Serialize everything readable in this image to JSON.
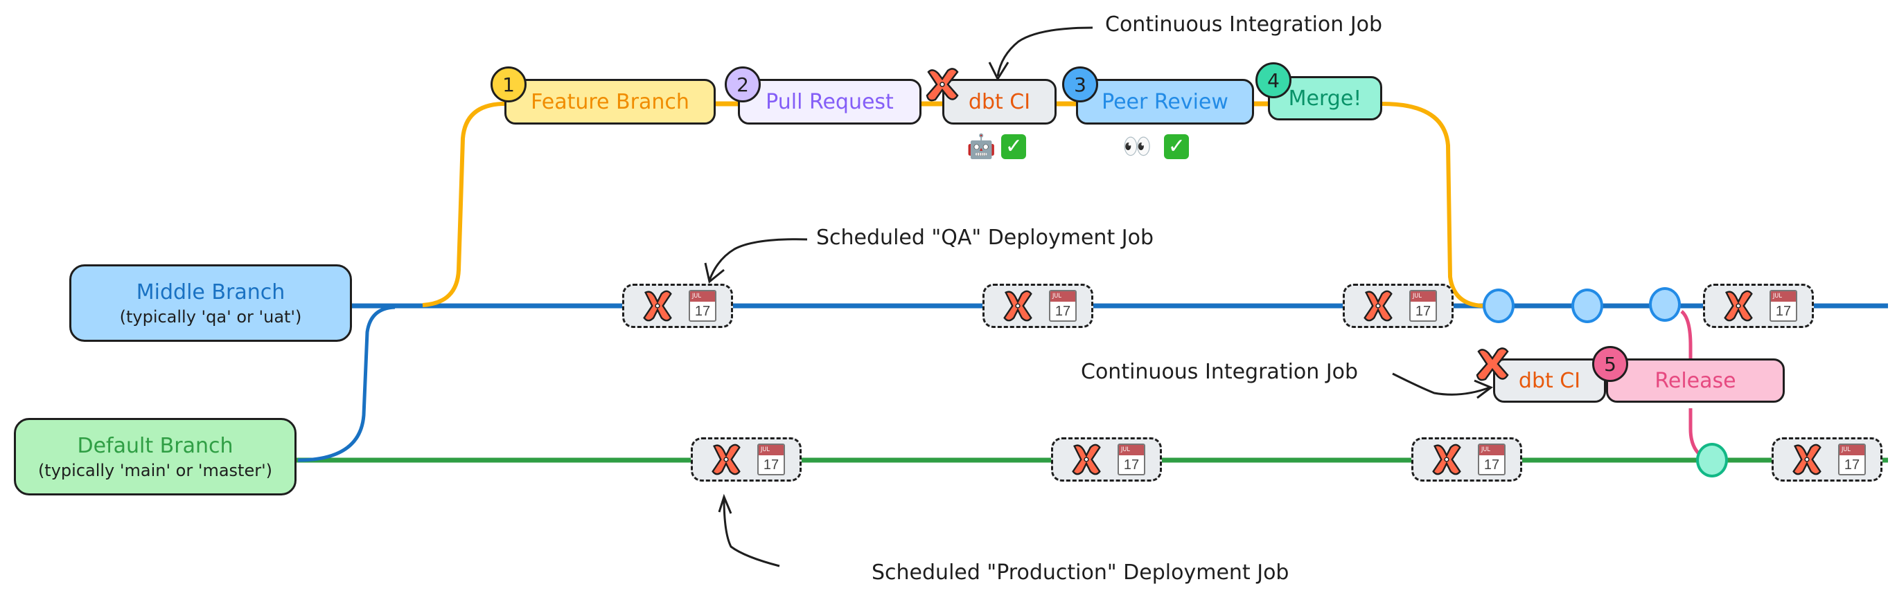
{
  "colors": {
    "middle_line": "#1971c2",
    "default_line": "#2f9e44",
    "feature_line": "#fab005",
    "release_line": "#e64980",
    "dbt_orange": "#ff6849"
  },
  "branches": {
    "middle": {
      "title": "Middle Branch",
      "subtitle": "(typically 'qa' or 'uat')"
    },
    "default": {
      "title": "Default Branch",
      "subtitle": "(typically 'main' or 'master')"
    }
  },
  "steps": [
    {
      "number": "1",
      "label": "Feature Branch"
    },
    {
      "number": "2",
      "label": "Pull Request"
    },
    {
      "number": "3",
      "label": "Peer Review"
    },
    {
      "number": "4",
      "label": "Merge!"
    },
    {
      "number": "5",
      "label": "Release"
    }
  ],
  "ci_nodes": {
    "top": {
      "label": "dbt CI",
      "status_icons": [
        "robot-emoji",
        "check-mark"
      ]
    },
    "bottom": {
      "label": "dbt CI"
    }
  },
  "peer_review_status": [
    "eyes-emoji",
    "check-mark"
  ],
  "annotations": {
    "ci_top": "Continuous Integration Job",
    "ci_bottom": "Continuous Integration Job",
    "qa_job": "Scheduled \"QA\" Deployment Job",
    "prod_job": "Scheduled \"Production\" Deployment Job"
  },
  "calendar": {
    "month": "JUL",
    "day": "17"
  },
  "emoji": {
    "robot": "🤖",
    "eyes": "👀",
    "check": "✓"
  },
  "middle_jobs_count": 4,
  "default_jobs_count": 4
}
